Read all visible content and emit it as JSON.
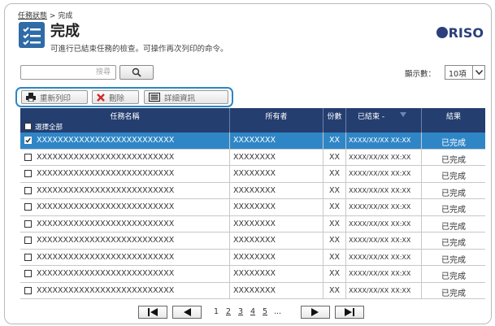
{
  "breadcrumb": {
    "parent": "任務狀態",
    "separator": ">",
    "current": "完成"
  },
  "page": {
    "title": "完成",
    "subtitle": "可進行已結束任務的檢查。可操作再次列印的命令。",
    "logo": "RISO"
  },
  "search": {
    "placeholder": "搜尋",
    "button_icon": "search-icon"
  },
  "display_count": {
    "label": "顯示數：",
    "value": "10項"
  },
  "actions": {
    "reprint_label": "重新列印",
    "delete_label": "刪除",
    "details_label": "詳細資訊"
  },
  "table": {
    "headers": {
      "name": "任務名稱",
      "owner": "所有者",
      "copies": "份數",
      "finished": "已結束 -",
      "result": "結果"
    },
    "select_all": "選擇全部",
    "rows": [
      {
        "name": "XXXXXXXXXXXXXXXXXXXXXXXXXX",
        "owner": "XXXXXXXX",
        "copies": "XX",
        "finished": "XXXX/XX/XX XX:XX",
        "result": "已完成",
        "checked": true
      },
      {
        "name": "XXXXXXXXXXXXXXXXXXXXXXXXXX",
        "owner": "XXXXXXXX",
        "copies": "XX",
        "finished": "XXXX/XX/XX XX:XX",
        "result": "已完成",
        "checked": false
      },
      {
        "name": "XXXXXXXXXXXXXXXXXXXXXXXXXX",
        "owner": "XXXXXXXX",
        "copies": "XX",
        "finished": "XXXX/XX/XX XX:XX",
        "result": "已完成",
        "checked": false
      },
      {
        "name": "XXXXXXXXXXXXXXXXXXXXXXXXXX",
        "owner": "XXXXXXXX",
        "copies": "XX",
        "finished": "XXXX/XX/XX XX:XX",
        "result": "已完成",
        "checked": false
      },
      {
        "name": "XXXXXXXXXXXXXXXXXXXXXXXXXX",
        "owner": "XXXXXXXX",
        "copies": "XX",
        "finished": "XXXX/XX/XX XX:XX",
        "result": "已完成",
        "checked": false
      },
      {
        "name": "XXXXXXXXXXXXXXXXXXXXXXXXXX",
        "owner": "XXXXXXXX",
        "copies": "XX",
        "finished": "XXXX/XX/XX XX:XX",
        "result": "已完成",
        "checked": false
      },
      {
        "name": "XXXXXXXXXXXXXXXXXXXXXXXXXX",
        "owner": "XXXXXXXX",
        "copies": "XX",
        "finished": "XXXX/XX/XX XX:XX",
        "result": "已完成",
        "checked": false
      },
      {
        "name": "XXXXXXXXXXXXXXXXXXXXXXXXXX",
        "owner": "XXXXXXXX",
        "copies": "XX",
        "finished": "XXXX/XX/XX XX:XX",
        "result": "已完成",
        "checked": false
      },
      {
        "name": "XXXXXXXXXXXXXXXXXXXXXXXXXX",
        "owner": "XXXXXXXX",
        "copies": "XX",
        "finished": "XXXX/XX/XX XX:XX",
        "result": "已完成",
        "checked": false
      },
      {
        "name": "XXXXXXXXXXXXXXXXXXXXXXXXXX",
        "owner": "XXXXXXXX",
        "copies": "XX",
        "finished": "XXXX/XX/XX XX:XX",
        "result": "已完成",
        "checked": false
      }
    ]
  },
  "pagination": {
    "pages": [
      "1",
      "2",
      "3",
      "4",
      "5"
    ],
    "ellipsis": "...",
    "current": "1"
  },
  "colors": {
    "header_bg": "#243e70",
    "selected_row": "#2f86c7",
    "accent_border": "#2c86c5",
    "title_icon": "#2f6ba6"
  }
}
